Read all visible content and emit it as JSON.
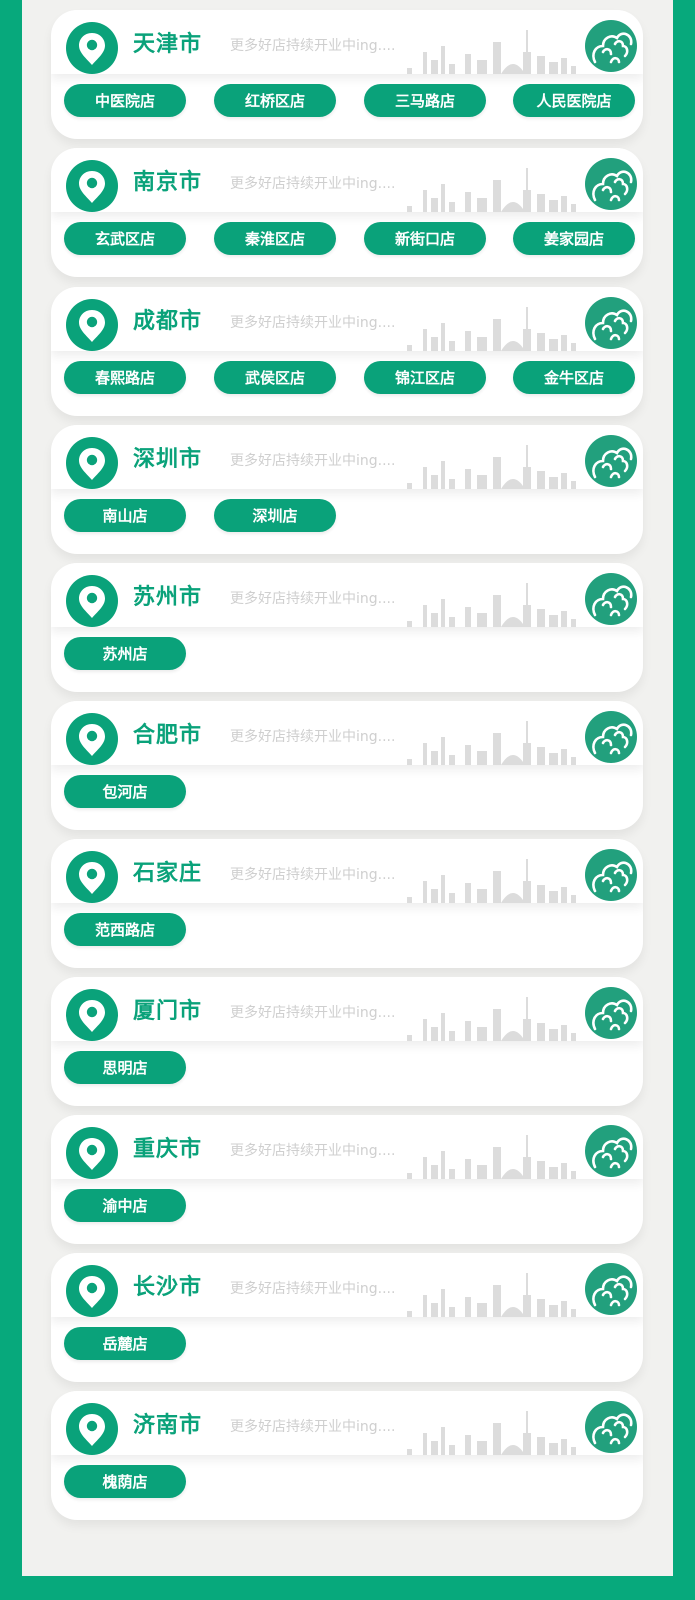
{
  "colors": {
    "brand_green": "#0aa27a",
    "border_green": "#07a97c",
    "slogan_gray": "#cfcfcf"
  },
  "slogan": "更多好店持续开业中ing....",
  "cities": [
    {
      "name": "天津市",
      "stores": [
        "中医院店",
        "红桥区店",
        "三马路店",
        "人民医院店"
      ]
    },
    {
      "name": "南京市",
      "stores": [
        "玄武区店",
        "秦淮区店",
        "新街口店",
        "姜家园店"
      ]
    },
    {
      "name": "成都市",
      "stores": [
        "春熙路店",
        "武侯区店",
        "锦江区店",
        "金牛区店"
      ]
    },
    {
      "name": "深圳市",
      "stores": [
        "南山店",
        "深圳店"
      ]
    },
    {
      "name": "苏州市",
      "stores": [
        "苏州店"
      ]
    },
    {
      "name": "合肥市",
      "stores": [
        "包河店"
      ]
    },
    {
      "name": "石家庄",
      "stores": [
        "范西路店"
      ]
    },
    {
      "name": "厦门市",
      "stores": [
        "思明店"
      ]
    },
    {
      "name": "重庆市",
      "stores": [
        "渝中店"
      ]
    },
    {
      "name": "长沙市",
      "stores": [
        "岳麓店"
      ]
    },
    {
      "name": "济南市",
      "stores": [
        "槐荫店"
      ]
    }
  ],
  "icons": {
    "location": "location-pin-icon",
    "cloud": "auspicious-cloud-icon",
    "skyline": "city-skyline-decoration"
  }
}
